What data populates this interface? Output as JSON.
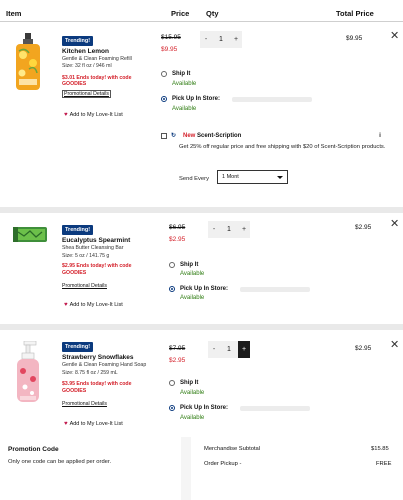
{
  "header": {
    "item": "Item",
    "price": "Price",
    "qty": "Qty",
    "total": "Total Price"
  },
  "items": [
    {
      "badge": "Trending!",
      "name": "Kitchen Lemon",
      "desc": "Gentle & Clean Foaming Refill",
      "size": "Size: 32 fl oz / 946 ml",
      "promo1": "$3.01 Ends today! with code",
      "promo2": "GOODIES",
      "details": "Promotional Details",
      "love": "Add to My Love-It List",
      "old_price": "$15.95",
      "new_price": "$9.95",
      "qty": "1",
      "total": "$9.95",
      "ship": "Ship It",
      "ship_avail": "Available",
      "pickup": "Pick Up In Store:",
      "pickup_avail": "Available"
    },
    {
      "badge": "Trending!",
      "name": "Eucalyptus Spearmint",
      "desc": "Shea Butter Cleansing Bar",
      "size": "Size: 5 oz / 141.75 g",
      "promo1": "$2.95 Ends today! with code",
      "promo2": "GOODIES",
      "details": "Promotional Details",
      "love": "Add to My Love-It List",
      "old_price": "$6.95",
      "new_price": "$2.95",
      "qty": "1",
      "total": "$2.95",
      "ship": "Ship It",
      "ship_avail": "Available",
      "pickup": "Pick Up In Store:",
      "pickup_avail": "Available"
    },
    {
      "badge": "Trending!",
      "name": "Strawberry Snowflakes",
      "desc": "Gentle & Clean Foaming Hand Soap",
      "size": "Size: 8.75 fl oz / 259 mL",
      "promo1": "$3.95 Ends today! with code",
      "promo2": "GOODIES",
      "details": "Promotional Details",
      "love": "Add to My Love-It List",
      "old_price": "$7.95",
      "new_price": "$2.95",
      "qty": "1",
      "total": "$2.95",
      "ship": "Ship It",
      "ship_avail": "Available",
      "pickup": "Pick Up In Store:",
      "pickup_avail": "Available"
    }
  ],
  "scent_scription": {
    "new_tag": "New",
    "label": "Scent-Scription",
    "desc": "Get 25% off regular price and free shipping with $20 of Scent-Scription products.",
    "send_every": "Send Every",
    "interval": "1 Mont"
  },
  "promotion": {
    "title": "Promotion Code",
    "note": "Only one code can be applied per order."
  },
  "summary": {
    "subtotal_label": "Merchandise Subtotal",
    "subtotal_value": "$15.85",
    "pickup_label": "Order Pickup -",
    "pickup_value": "FREE"
  },
  "icons": {
    "close": "close-icon",
    "heart": "heart-icon",
    "info": "info-icon",
    "caret": "chevron-down-icon"
  },
  "colors": {
    "badge": "#0b3a7e",
    "sale": "#d4202a",
    "available": "#2f7d12"
  }
}
